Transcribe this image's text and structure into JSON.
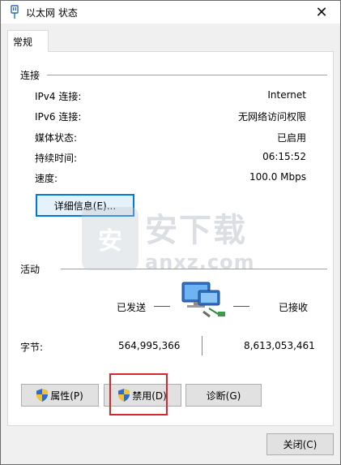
{
  "window": {
    "title": "以太网 状态",
    "close_glyph": "✕"
  },
  "tabs": [
    {
      "label": "常规"
    }
  ],
  "connection": {
    "section_label": "连接",
    "rows": [
      {
        "label": "IPv4 连接:",
        "value": "Internet"
      },
      {
        "label": "IPv6 连接:",
        "value": "无网络访问权限"
      },
      {
        "label": "媒体状态:",
        "value": "已启用"
      },
      {
        "label": "持续时间:",
        "value": "06:15:52"
      },
      {
        "label": "速度:",
        "value": "100.0 Mbps"
      }
    ],
    "details_button": "详细信息(E)..."
  },
  "activity": {
    "section_label": "活动",
    "sent_label": "已发送",
    "received_label": "已接收",
    "bytes_label": "字节:",
    "bytes_sent": "564,995,366",
    "bytes_received": "8,613,053,461"
  },
  "actions": {
    "properties_button": "属性(P)",
    "disable_button": "禁用(D)",
    "diagnose_button": "诊断(G)"
  },
  "footer": {
    "close_button": "关闭(C)"
  },
  "watermark": {
    "text_cn": "安下载",
    "text_en": "anxz.com",
    "logo_glyph": "安"
  },
  "colors": {
    "focus_accent": "#0078d7",
    "highlight_red": "#d4282f"
  }
}
